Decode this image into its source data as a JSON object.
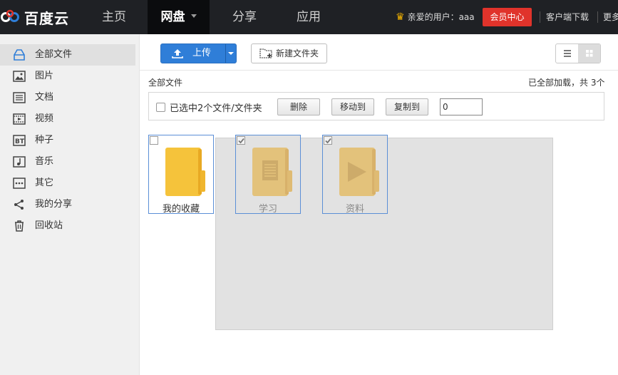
{
  "header": {
    "logo_text": "百度云",
    "nav": [
      {
        "label": "主页",
        "active": false
      },
      {
        "label": "网盘",
        "active": true
      },
      {
        "label": "分享",
        "active": false
      },
      {
        "label": "应用",
        "active": false
      }
    ],
    "user_greeting": "亲爱的用户：aaa",
    "vip_label": "会员中心",
    "client_download": "客户端下载",
    "more": "更多"
  },
  "sidebar": {
    "items": [
      {
        "label": "全部文件",
        "icon": "all-files-icon",
        "active": true
      },
      {
        "label": "图片",
        "icon": "image-icon",
        "active": false
      },
      {
        "label": "文档",
        "icon": "document-icon",
        "active": false
      },
      {
        "label": "视频",
        "icon": "video-icon",
        "active": false
      },
      {
        "label": "种子",
        "icon": "torrent-icon",
        "active": false
      },
      {
        "label": "音乐",
        "icon": "music-icon",
        "active": false
      },
      {
        "label": "其它",
        "icon": "other-icon",
        "active": false
      },
      {
        "label": "我的分享",
        "icon": "share-icon",
        "active": false
      },
      {
        "label": "回收站",
        "icon": "trash-icon",
        "active": false
      }
    ]
  },
  "toolbar": {
    "upload_label": "上传",
    "new_folder_label": "新建文件夹"
  },
  "breadcrumb": "全部文件",
  "loaded_status": "已全部加载，共 3个",
  "selection": {
    "text": "已选中2个文件/文件夹",
    "delete_label": "删除",
    "move_label": "移动到",
    "copy_label": "复制到",
    "input_value": "0"
  },
  "files": [
    {
      "name": "我的收藏",
      "selected": false,
      "folder_icon": "folder-icon"
    },
    {
      "name": "学习",
      "selected": true,
      "folder_icon": "folder-document-icon"
    },
    {
      "name": "资料",
      "selected": true,
      "folder_icon": "folder-video-icon"
    }
  ],
  "colors": {
    "topbar": "#1f2125",
    "vip": "#e0332b",
    "upload": "#2f7ed8",
    "folder": "#f5c33b",
    "folder_selected": "#e3c27b"
  }
}
